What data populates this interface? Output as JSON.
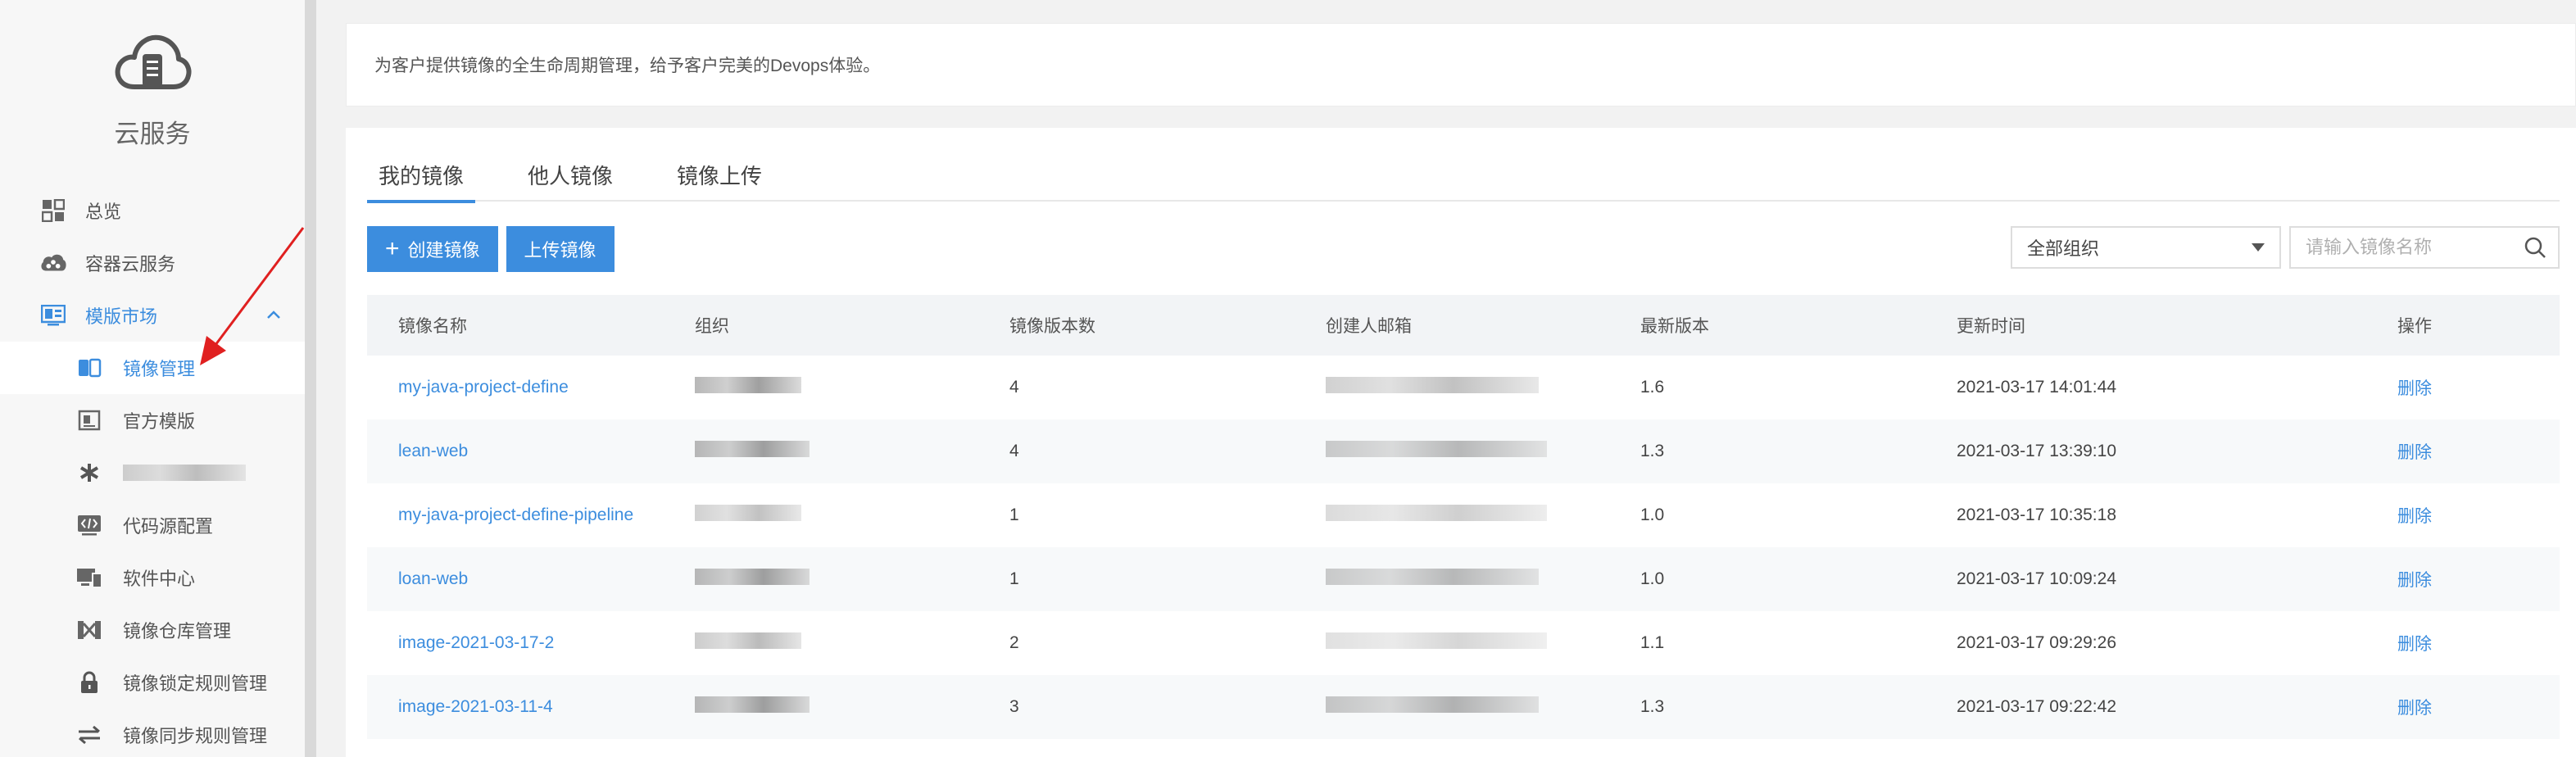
{
  "brand": {
    "name": "云服务",
    "icon": "cloud-server-icon"
  },
  "nav": {
    "items": [
      {
        "label": "总览",
        "icon": "dashboard-icon"
      },
      {
        "label": "容器云服务",
        "icon": "container-cloud-icon"
      },
      {
        "label": "模版市场",
        "icon": "template-market-icon"
      }
    ],
    "subitems": [
      {
        "label": "镜像管理",
        "icon": "image-manage-icon"
      },
      {
        "label": "官方模版",
        "icon": "official-template-icon"
      },
      {
        "label": "",
        "icon": "asterisk-icon"
      },
      {
        "label": "代码源配置",
        "icon": "code-source-icon"
      },
      {
        "label": "软件中心",
        "icon": "software-center-icon"
      },
      {
        "label": "镜像仓库管理",
        "icon": "registry-icon"
      },
      {
        "label": "镜像锁定规则管理",
        "icon": "lock-icon"
      },
      {
        "label": "镜像同步规则管理",
        "icon": "sync-icon"
      }
    ]
  },
  "notice": {
    "text": "为客户提供镜像的全生命周期管理，给予客户完美的Devops体验。"
  },
  "tabs": [
    {
      "label": "我的镜像"
    },
    {
      "label": "他人镜像"
    },
    {
      "label": "镜像上传"
    }
  ],
  "toolbar": {
    "create_label": "创建镜像",
    "upload_label": "上传镜像"
  },
  "filters": {
    "org_selected": "全部组织",
    "search_placeholder": "请输入镜像名称"
  },
  "table": {
    "headers": [
      "镜像名称",
      "组织",
      "镜像版本数",
      "创建人邮箱",
      "最新版本",
      "更新时间",
      "操作"
    ],
    "rows": [
      {
        "name": "my-java-project-define",
        "org": "",
        "versions": "4",
        "email": "",
        "latest": "1.6",
        "updated": "2021-03-17 14:01:44",
        "action": "删除"
      },
      {
        "name": "lean-web",
        "org": "",
        "versions": "4",
        "email": "",
        "latest": "1.3",
        "updated": "2021-03-17 13:39:10",
        "action": "删除"
      },
      {
        "name": "my-java-project-define-pipeline",
        "org": "",
        "versions": "1",
        "email": "",
        "latest": "1.0",
        "updated": "2021-03-17 10:35:18",
        "action": "删除"
      },
      {
        "name": "loan-web",
        "org": "",
        "versions": "1",
        "email": "",
        "latest": "1.0",
        "updated": "2021-03-17 10:09:24",
        "action": "删除"
      },
      {
        "name": "image-2021-03-17-2",
        "org": "",
        "versions": "2",
        "email": "",
        "latest": "1.1",
        "updated": "2021-03-17 09:29:26",
        "action": "删除"
      },
      {
        "name": "image-2021-03-11-4",
        "org": "",
        "versions": "3",
        "email": "",
        "latest": "1.3",
        "updated": "2021-03-17 09:22:42",
        "action": "删除"
      }
    ]
  },
  "colors": {
    "accent": "#3c8dde",
    "annotation_arrow": "#e02020"
  }
}
